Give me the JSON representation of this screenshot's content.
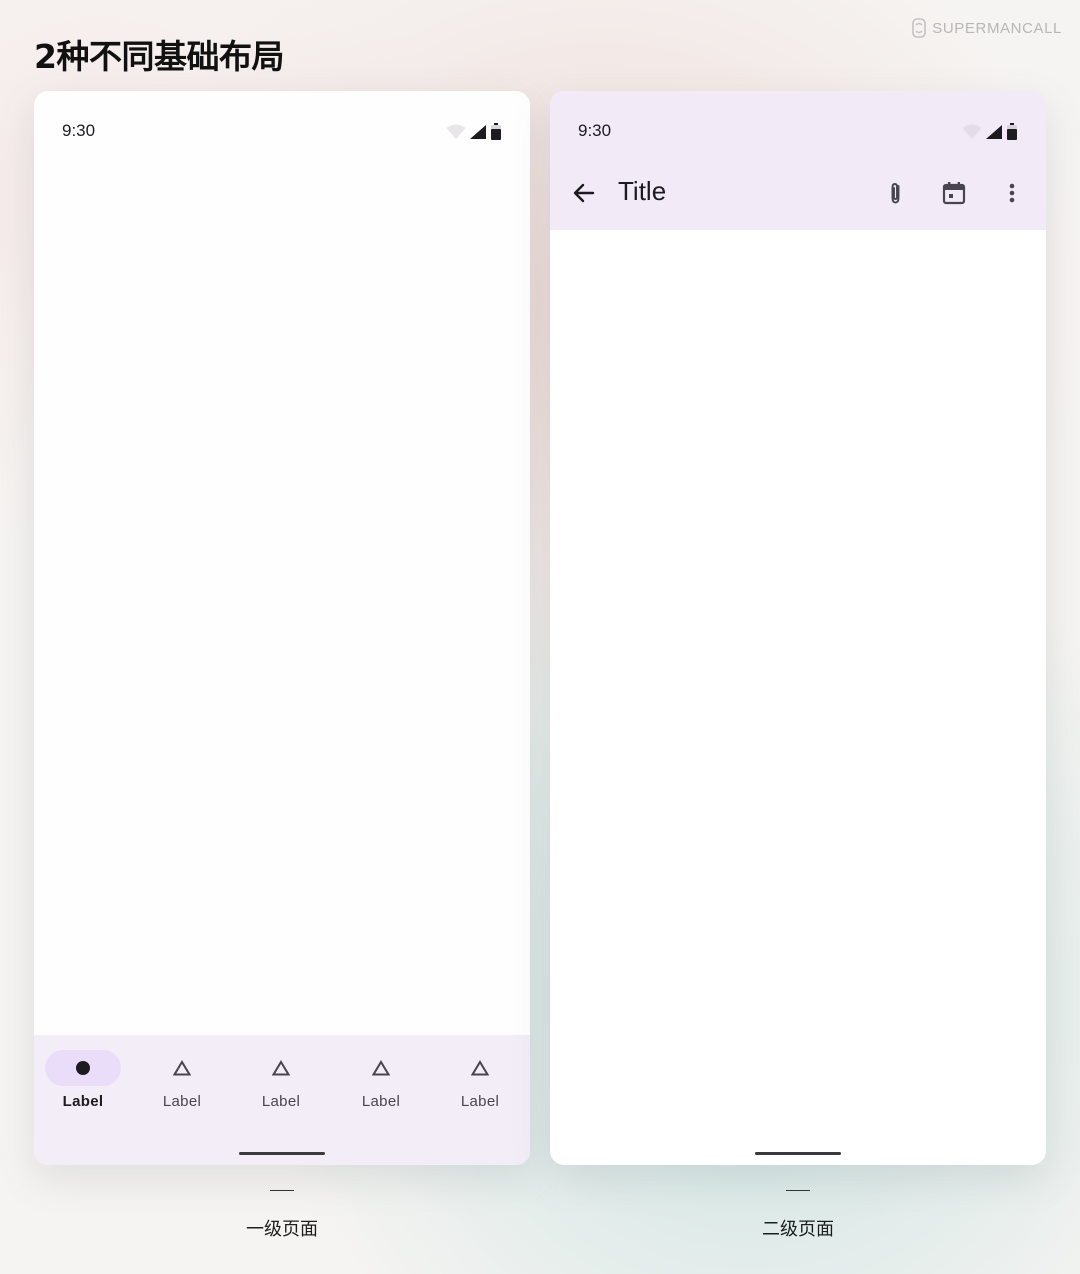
{
  "heading": "2种不同基础布局",
  "brand": {
    "name": "SUPERMANCALL",
    "icon": "brand-logo-icon"
  },
  "left_screen": {
    "status": {
      "time": "9:30",
      "icons": [
        "wifi-icon",
        "signal-icon",
        "battery-icon"
      ]
    },
    "nav_bar": {
      "items": [
        {
          "label": "Label",
          "icon": "dot-icon",
          "active": true
        },
        {
          "label": "Label",
          "icon": "triangle-icon",
          "active": false
        },
        {
          "label": "Label",
          "icon": "triangle-icon",
          "active": false
        },
        {
          "label": "Label",
          "icon": "triangle-icon",
          "active": false
        },
        {
          "label": "Label",
          "icon": "triangle-icon",
          "active": false
        }
      ]
    },
    "caption": "一级页面"
  },
  "right_screen": {
    "status": {
      "time": "9:30",
      "icons": [
        "wifi-icon",
        "signal-icon",
        "battery-icon"
      ]
    },
    "app_bar": {
      "title": "Title",
      "navigation_icon": "arrow-back-icon",
      "actions": [
        "attach-icon",
        "calendar-icon",
        "more-vert-icon"
      ]
    },
    "caption": "二级页面"
  },
  "colors": {
    "surface_tint": "#f3eaf7",
    "nav_indicator": "#e9ddf9",
    "on_surface": "#1d1b20"
  }
}
